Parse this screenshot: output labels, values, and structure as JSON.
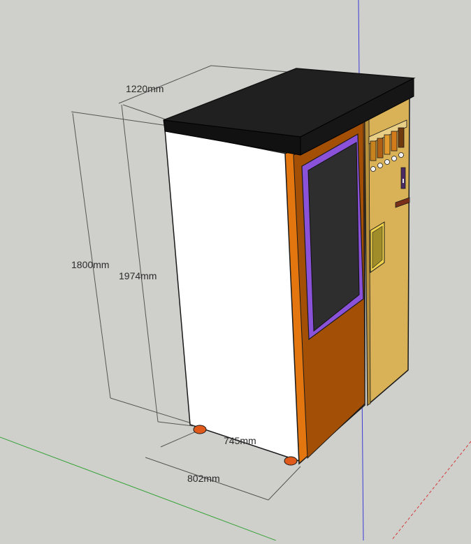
{
  "dimensions": {
    "top_width": "1220mm",
    "height_body": "1800mm",
    "height_total": "1974mm",
    "depth_inner": "745mm",
    "depth_outer": "802mm"
  },
  "colors": {
    "background": "#cfcfcb",
    "top_cover": "#1f1f1f",
    "side_panel": "#ffffff",
    "door_frame": "#e3760f",
    "door_panel": "#a34f06",
    "screen_frame": "#8a52d8",
    "screen": "#2e2e2e",
    "control_panel": "#d9b257",
    "axis_blue": "#3b3bd6",
    "axis_green": "#3aa43a",
    "axis_red": "#d23a3a"
  }
}
